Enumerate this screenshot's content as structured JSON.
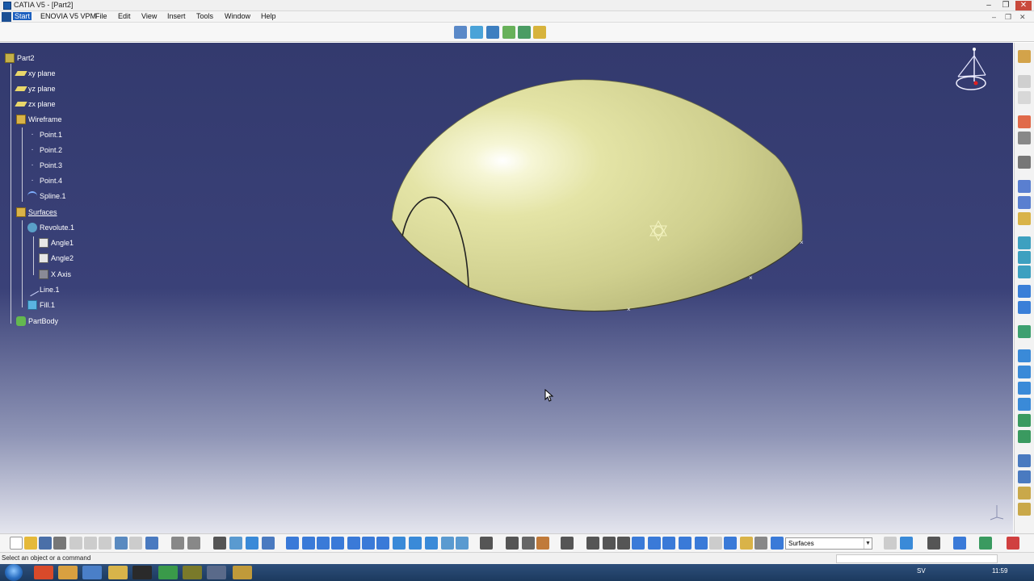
{
  "window": {
    "title": "CATIA V5 - [Part2]",
    "minimize": "–",
    "restore": "❐",
    "close": "✕"
  },
  "menubar": {
    "items": [
      "Start",
      "ENOVIA V5 VPM",
      "File",
      "Edit",
      "View",
      "Insert",
      "Tools",
      "Window",
      "Help"
    ]
  },
  "tree": {
    "root": "Part2",
    "nodes": [
      {
        "label": "xy plane",
        "icon": "plane-icon"
      },
      {
        "label": "yz plane",
        "icon": "plane-icon"
      },
      {
        "label": "zx plane",
        "icon": "plane-icon"
      },
      {
        "label": "Wireframe",
        "icon": "geometrical-set-icon"
      },
      {
        "label": "Point.1",
        "icon": "point-icon"
      },
      {
        "label": "Point.2",
        "icon": "point-icon"
      },
      {
        "label": "Point.3",
        "icon": "point-icon"
      },
      {
        "label": "Point.4",
        "icon": "point-icon"
      },
      {
        "label": "Spline.1",
        "icon": "spline-icon"
      },
      {
        "label": "Surfaces",
        "icon": "geometrical-set-icon"
      },
      {
        "label": "Revolute.1",
        "icon": "revolute-icon"
      },
      {
        "label": "Angle1",
        "icon": "parameter-icon"
      },
      {
        "label": "Angle2",
        "icon": "parameter-icon"
      },
      {
        "label": "X Axis",
        "icon": "axis-icon"
      },
      {
        "label": "Line.1",
        "icon": "line-icon"
      },
      {
        "label": "Fill.1",
        "icon": "fill-icon"
      },
      {
        "label": "PartBody",
        "icon": "partbody-icon"
      }
    ]
  },
  "toolbar": {
    "filter_value": "Surfaces"
  },
  "status": {
    "message": "Select an object or a command"
  },
  "taskbar": {
    "lang": "SV",
    "clock": "11:59"
  },
  "colors": {
    "surface": "#e6e6a6",
    "viewport_top": "#333a6e",
    "selection": "#1c5fbf"
  }
}
